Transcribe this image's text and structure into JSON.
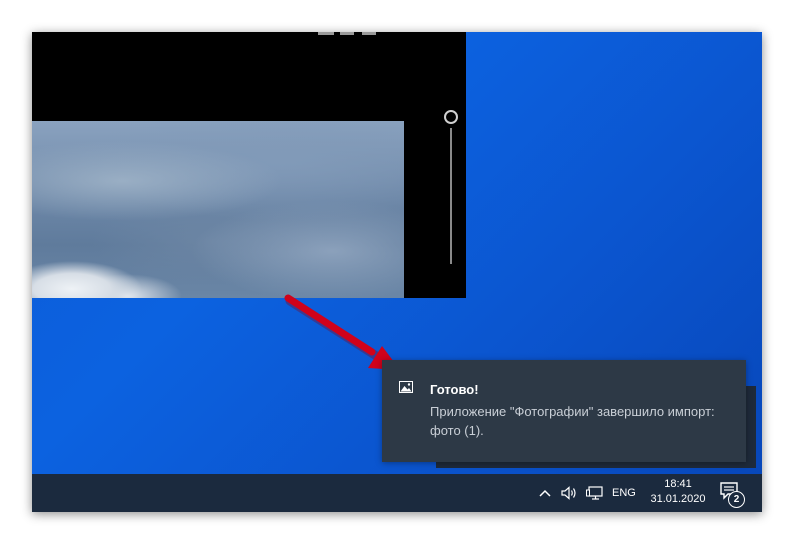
{
  "notification": {
    "title": "Готово!",
    "body": "Приложение \"Фотографии\" завершило импорт: фото (1).",
    "app_icon": "image-icon"
  },
  "taskbar": {
    "language": "ENG",
    "time": "18:41",
    "date": "31.01.2020",
    "notification_count": "2",
    "icons": [
      "chevron-up-icon",
      "speaker-icon",
      "network-icon",
      "action-center-icon"
    ]
  },
  "colors": {
    "desktop": "#0a5ad6",
    "taskbar": "#1b2a3e",
    "toast": "#2d3946",
    "arrow": "#d0021b"
  }
}
